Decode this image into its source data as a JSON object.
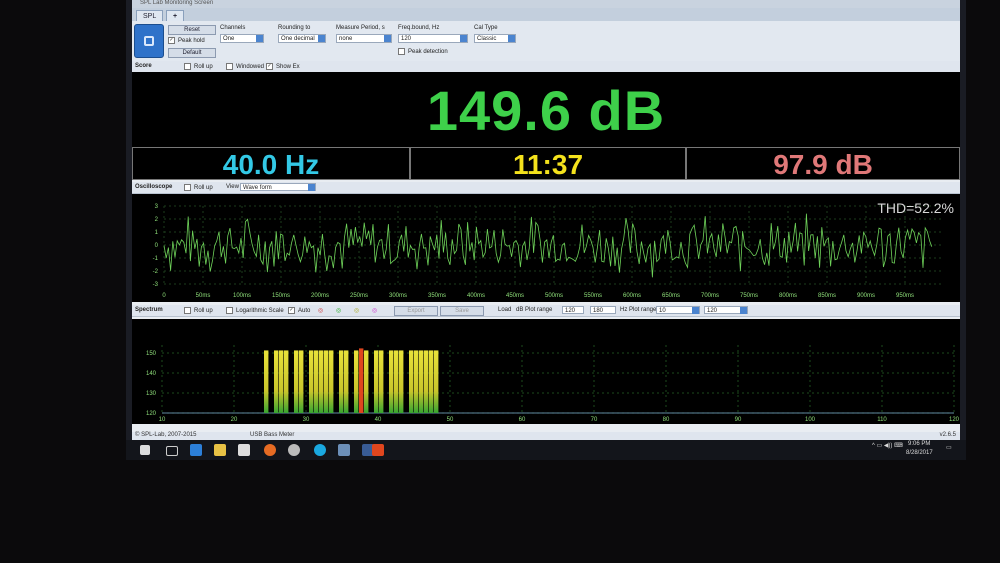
{
  "window": {
    "title": "SPL Lab Monitoring Screen",
    "tabs": [
      "SPL",
      "+"
    ]
  },
  "toolbar": {
    "reset_label": "Reset",
    "peak_hold_label": "Peak hold",
    "default_label": "Default",
    "channels": {
      "label": "Channels",
      "value": "One"
    },
    "rounding": {
      "label": "Rounding to",
      "value": "One decimal"
    },
    "measure": {
      "label": "Measure Period, s",
      "value": "none"
    },
    "freq": {
      "label": "Freq.bound, Hz",
      "value": "120"
    },
    "cal": {
      "label": "Cal Type",
      "value": "Classic"
    },
    "peak_detection_label": "Peak detection"
  },
  "score_bar": {
    "title": "Score",
    "roll_up": "Roll up",
    "windowed": "Windowed",
    "show_ex": "Show Ex"
  },
  "score": {
    "main_value": "149.6 dB",
    "frequency": "40.0 Hz",
    "time": "11:37",
    "secondary": "97.9 dB"
  },
  "osc_bar": {
    "title": "Oscilloscope",
    "roll_up": "Roll up",
    "view_label": "View",
    "view_value": "Wave form"
  },
  "osc": {
    "thd": "THD=52.2%",
    "y_ticks": [
      "3",
      "2",
      "1",
      "0",
      "-1",
      "-2",
      "-3"
    ],
    "x_ticks": [
      "0",
      "50ms",
      "100ms",
      "150ms",
      "200ms",
      "250ms",
      "300ms",
      "350ms",
      "400ms",
      "450ms",
      "500ms",
      "550ms",
      "600ms",
      "650ms",
      "700ms",
      "750ms",
      "800ms",
      "850ms",
      "900ms",
      "950ms"
    ]
  },
  "spec_bar": {
    "title": "Spectrum",
    "roll_up": "Roll up",
    "log_scale": "Logarithmic Scale",
    "auto": "Auto",
    "export": "Export",
    "save": "Save",
    "load": "Load",
    "db_range_label": "dB Plot range",
    "db_min": "120",
    "db_max": "180",
    "hz_range_label": "Hz Plot range",
    "hz_min": "10",
    "hz_max": "120"
  },
  "spectrum": {
    "y_ticks": [
      "150",
      "140",
      "130",
      "120"
    ],
    "x_ticks": [
      "10",
      "20",
      "30",
      "40",
      "50",
      "60",
      "70",
      "80",
      "90",
      "100",
      "110",
      "120"
    ],
    "bar_levels": [
      0.92,
      0.0,
      0.92,
      0.92,
      0.92,
      0.0,
      0.92,
      0.92,
      0.0,
      0.92,
      0.92,
      0.92,
      0.92,
      0.92,
      0.0,
      0.92,
      0.92,
      0.0,
      0.92,
      0.95,
      0.92,
      0.0,
      0.92,
      0.92,
      0.0,
      0.92,
      0.92,
      0.92,
      0.0,
      0.92,
      0.92,
      0.92,
      0.92,
      0.92,
      0.92
    ]
  },
  "status": {
    "copyright": "© SPL-Lab, 2007-2015",
    "device": "USB Bass Meter",
    "version": "v2.6.5"
  },
  "taskbar": {
    "time": "9:06 PM",
    "date": "8/28/2017"
  },
  "colors": {
    "green": "#3ed04a",
    "cyan": "#33c9e6",
    "yellow": "#f4e21c",
    "pink": "#e07878",
    "wave": "#6fd35a",
    "bar_yellow": "#e9e23a",
    "bar_green": "#37a531",
    "bar_red": "#e0461e"
  }
}
